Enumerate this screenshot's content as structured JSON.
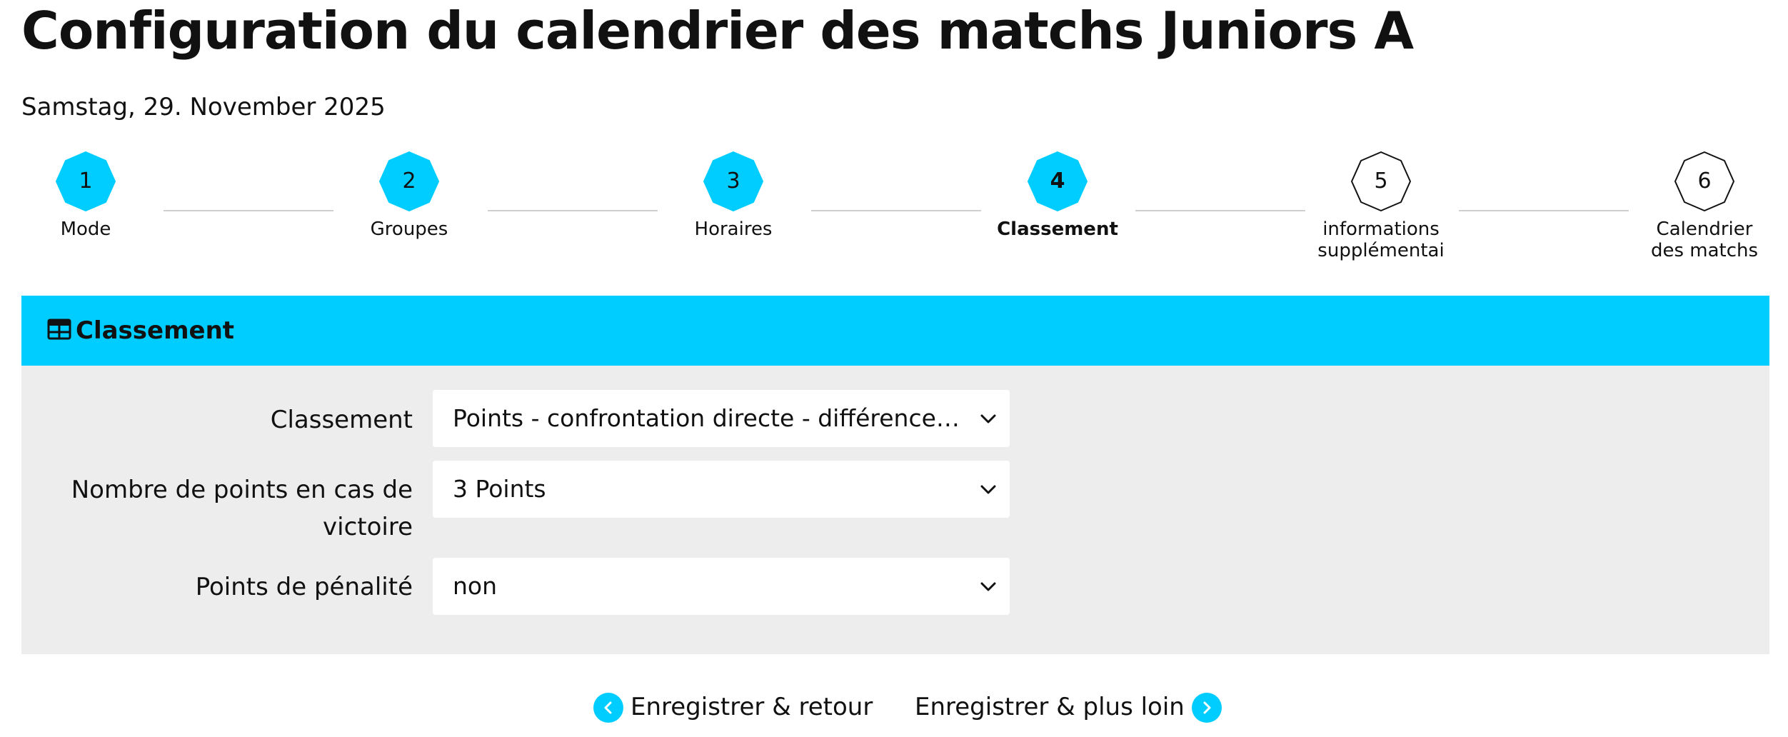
{
  "page": {
    "title": "Configuration du calendrier des matchs Juniors A",
    "date": "Samstag, 29. November 2025"
  },
  "stepper": {
    "steps": [
      {
        "number": "1",
        "label": "Mode",
        "state": "completed"
      },
      {
        "number": "2",
        "label": "Groupes",
        "state": "completed"
      },
      {
        "number": "3",
        "label": "Horaires",
        "state": "completed"
      },
      {
        "number": "4",
        "label": "Classement",
        "state": "active"
      },
      {
        "number": "5",
        "label_line1": "informations",
        "label_line2": "supplémentai",
        "state": "pending"
      },
      {
        "number": "6",
        "label_line1": "Calendrier",
        "label_line2": "des matchs",
        "state": "pending"
      }
    ]
  },
  "panel": {
    "icon": "table-icon",
    "title": "Classement"
  },
  "form": {
    "classement": {
      "label": "Classement",
      "value": "Points - confrontation directe - différence de buts"
    },
    "victory_points": {
      "label_line1": "Nombre de points en cas de",
      "label_line2": "victoire",
      "value": "3 Points"
    },
    "penalty_points": {
      "label": "Points de pénalité",
      "value": "non"
    }
  },
  "footer": {
    "back_label": "Enregistrer & retour",
    "next_label": "Enregistrer & plus loin"
  },
  "colors": {
    "accent": "#00cdff",
    "panel_background": "#ededed",
    "step_line": "#cfcfcf"
  }
}
